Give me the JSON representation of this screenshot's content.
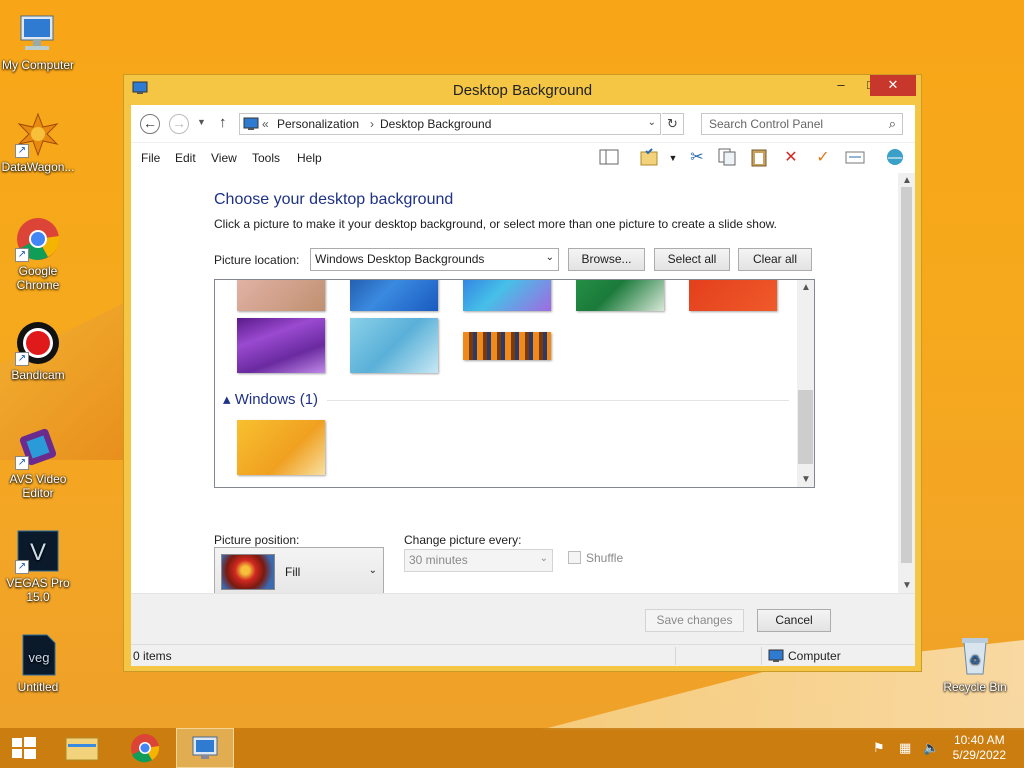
{
  "desktop": {
    "icons": [
      {
        "label": "My Computer"
      },
      {
        "label": "DataWagon..."
      },
      {
        "label": "Google Chrome"
      },
      {
        "label": "Bandicam"
      },
      {
        "label": "AVS Video Editor"
      },
      {
        "label": "VEGAS Pro 15.0"
      },
      {
        "label": "Untitled"
      },
      {
        "label": "Recycle Bin"
      }
    ]
  },
  "window": {
    "title": "Desktop Background",
    "controls": {
      "minimize": "–",
      "maximize": "□",
      "close": "✕"
    }
  },
  "address": {
    "prefix": "«",
    "crumbs": [
      "Personalization",
      "Desktop Background"
    ],
    "separator": "›",
    "search_placeholder": "Search Control Panel"
  },
  "menu": [
    "File",
    "Edit",
    "View",
    "Tools",
    "Help"
  ],
  "content": {
    "heading": "Choose your desktop background",
    "subtext": "Click a picture to make it your desktop background, or select more than one picture to create a slide show.",
    "picture_location_label": "Picture location:",
    "picture_location_value": "Windows Desktop Backgrounds",
    "buttons": {
      "browse": "Browse...",
      "select_all": "Select all",
      "clear_all": "Clear all"
    },
    "group_label": "Windows (1)",
    "picture_position_label": "Picture position:",
    "picture_position_value": "Fill",
    "change_every_label": "Change picture every:",
    "change_every_value": "30 minutes",
    "shuffle_label": "Shuffle"
  },
  "footer": {
    "save": "Save changes",
    "cancel": "Cancel"
  },
  "status": {
    "items": "0 items",
    "location": "Computer"
  },
  "taskbar": {
    "time": "10:40 AM",
    "date": "5/29/2022"
  },
  "colors": {
    "accent_heading": "#1e3287",
    "window_frame": "#f5c644",
    "close_button": "#c7372b"
  }
}
